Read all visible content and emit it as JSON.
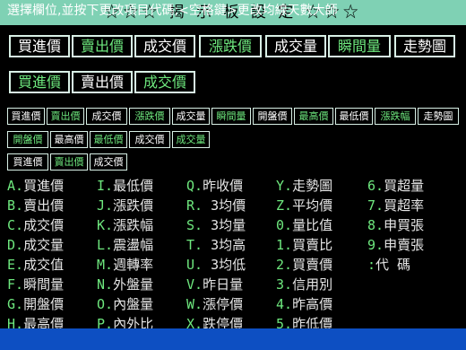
{
  "title": "☆☆☆  揭 示 板 設 定  ☆☆☆",
  "row1": [
    "買進價",
    "賣出價",
    "成交價",
    "漲跌價",
    "成交量",
    "瞬間量",
    "走勢圖"
  ],
  "row2": [
    "買進價",
    "賣出價",
    "成交價"
  ],
  "row3": [
    "買進價",
    "賣出價",
    "成交價",
    "漲跌價",
    "成交量",
    "瞬間量",
    "開盤價",
    "最高價",
    "最低價",
    "漲跌幅",
    "走勢圖"
  ],
  "row4": [
    "開盤價",
    "最高價",
    "最低價",
    "成交價",
    "成交量"
  ],
  "row5": [
    "買進價",
    "賣出價",
    "成交價"
  ],
  "options": {
    "col1": [
      {
        "key": "A.",
        "label": "買進價"
      },
      {
        "key": "B.",
        "label": "賣出價"
      },
      {
        "key": "C.",
        "label": "成交價"
      },
      {
        "key": "D.",
        "label": "成交量"
      },
      {
        "key": "E.",
        "label": "成交值"
      },
      {
        "key": "F.",
        "label": "瞬間量"
      },
      {
        "key": "G.",
        "label": "開盤價"
      },
      {
        "key": "H.",
        "label": "最高價"
      }
    ],
    "col2": [
      {
        "key": "I.",
        "label": "最低價"
      },
      {
        "key": "J.",
        "label": "漲跌價"
      },
      {
        "key": "K.",
        "label": "漲跌幅"
      },
      {
        "key": "L.",
        "label": "震盪幅"
      },
      {
        "key": "M.",
        "label": "週轉率"
      },
      {
        "key": "N.",
        "label": "外盤量"
      },
      {
        "key": "O.",
        "label": "內盤量"
      },
      {
        "key": "P.",
        "label": "內外比"
      }
    ],
    "col3": [
      {
        "key": "Q.",
        "label": "昨收價"
      },
      {
        "key": "R.",
        "label": " 3均價"
      },
      {
        "key": "S.",
        "label": " 3均量"
      },
      {
        "key": "T.",
        "label": " 3均高"
      },
      {
        "key": "U.",
        "label": " 3均低"
      },
      {
        "key": "V.",
        "label": "昨日量"
      },
      {
        "key": "W.",
        "label": "漲停價"
      },
      {
        "key": "X.",
        "label": "跌停價"
      }
    ],
    "col4": [
      {
        "key": "Y.",
        "label": "走勢圖"
      },
      {
        "key": "Z.",
        "label": "平均價"
      },
      {
        "key": "0.",
        "label": "量比值"
      },
      {
        "key": "1.",
        "label": "買賣比"
      },
      {
        "key": "2.",
        "label": "買賣價"
      },
      {
        "key": "3.",
        "label": "信用別"
      },
      {
        "key": "4.",
        "label": "昨高價"
      },
      {
        "key": "5.",
        "label": "昨低價"
      }
    ],
    "col5": [
      {
        "key": "6.",
        "label": "買超量"
      },
      {
        "key": "7.",
        "label": "買超率"
      },
      {
        "key": "8.",
        "label": "申買張"
      },
      {
        "key": "9.",
        "label": "申賣張"
      },
      {
        "key": " :",
        "label": "代  碼"
      }
    ]
  },
  "status": "選擇欄位,並按下更改項目代碼;<空格鍵>更改均線天數大師"
}
